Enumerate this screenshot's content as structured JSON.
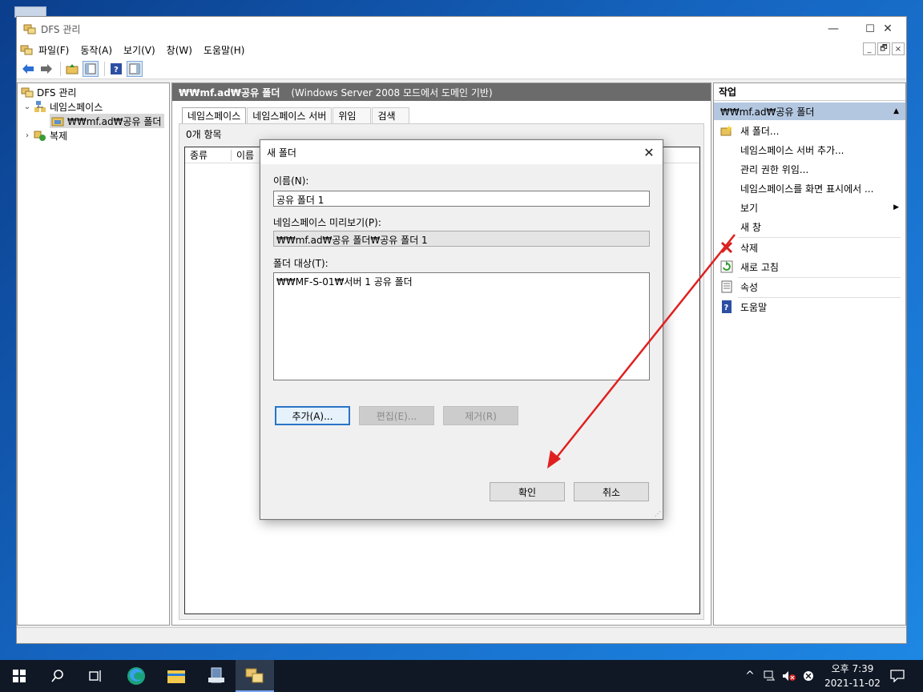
{
  "window": {
    "title": "DFS 관리",
    "controls": {
      "minimize": "—",
      "maximize": "☐",
      "close": "✕"
    }
  },
  "menubar": {
    "items": [
      "파일(F)",
      "동작(A)",
      "보기(V)",
      "창(W)",
      "도움말(H)"
    ],
    "mdi": {
      "minimize": "_",
      "restore": "🗗",
      "close": "×"
    }
  },
  "tree": {
    "root": "DFS 관리",
    "namespaces": "네임스페이스",
    "namespace_item": "₩₩mf.ad₩공유 폴더",
    "replication": "복제"
  },
  "center": {
    "header_path": "₩₩mf.ad₩공유 폴더",
    "header_mode": "(Windows Server 2008 모드에서 도메인 기반)",
    "tabs": [
      "네임스페이스",
      "네임스페이스 서버",
      "위임",
      "검색"
    ],
    "item_count": "0개 항목",
    "columns": [
      "종류",
      "이름"
    ]
  },
  "actions": {
    "title": "작업",
    "section": "₩₩mf.ad₩공유 폴더",
    "items": [
      {
        "label": "새 폴더...",
        "icon": "new-folder-icon"
      },
      {
        "label": "네임스페이스 서버 추가...",
        "icon": ""
      },
      {
        "label": "관리 권한 위임...",
        "icon": ""
      },
      {
        "label": "네임스페이스를 화면 표시에서 ...",
        "icon": ""
      },
      {
        "label": "보기",
        "icon": "",
        "submenu": true
      },
      {
        "label": "새 창",
        "icon": ""
      },
      {
        "label": "삭제",
        "icon": "delete-icon"
      },
      {
        "label": "새로 고침",
        "icon": "refresh-icon"
      },
      {
        "label": "속성",
        "icon": "properties-icon"
      },
      {
        "label": "도움말",
        "icon": "help-icon"
      }
    ]
  },
  "dialog": {
    "title": "새 폴더",
    "name_label": "이름(N):",
    "name_value": "공유 폴더 1",
    "preview_label": "네임스페이스 미리보기(P):",
    "preview_value": "₩₩mf.ad₩공유 폴더₩공유 폴더 1",
    "targets_label": "폴더 대상(T):",
    "targets_value": "₩₩MF-S-01₩서버 1 공유 폴더",
    "add_button": "추가(A)...",
    "edit_button": "편집(E)...",
    "remove_button": "제거(R)",
    "ok_button": "확인",
    "cancel_button": "취소",
    "close": "✕"
  },
  "taskbar": {
    "clock_time": "오후 7:39",
    "clock_date": "2021-11-02",
    "tray_chevron": "^"
  },
  "colors": {
    "annotation_arrow": "#e02020",
    "actions_section_bg": "#b3c7e0",
    "center_header_bg": "#6b6b6b",
    "focus_border": "#2a73c7"
  }
}
